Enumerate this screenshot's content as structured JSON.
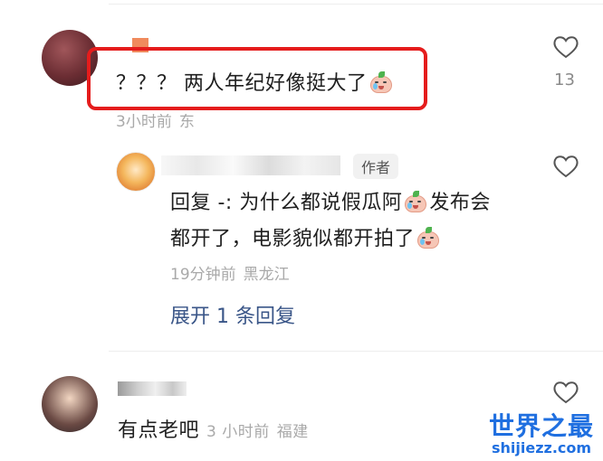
{
  "comments": [
    {
      "text": "？？？ 两人年纪好像挺大了",
      "meta_time": "3小时前",
      "meta_location": "东",
      "likes": "13"
    }
  ],
  "reply": {
    "author_badge": "作者",
    "line1": "回复 -: 为什么都说假瓜阿",
    "line1_tail": "发布会",
    "line2": "都开了，电影貌似都开拍了",
    "meta_time": "19分钟前",
    "meta_location": "黑龙江",
    "expand_label": "展开 1 条回复"
  },
  "comment3": {
    "text": "有点老吧",
    "meta_time": "3 小时前",
    "meta_location": "福建"
  },
  "watermark": {
    "name": "世界之最",
    "domain": "shijiezz.com"
  },
  "colors": {
    "highlight": "#e51c1c",
    "link": "#3a5688",
    "meta": "#a9a9a9",
    "watermark": "#1f6fe0"
  },
  "icons": {
    "like": "heart-outline-icon",
    "emoji": "crying-face-emoji"
  }
}
